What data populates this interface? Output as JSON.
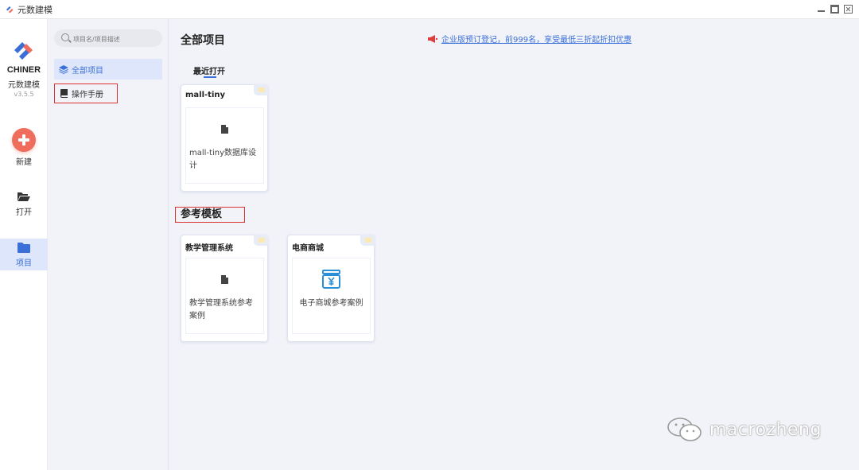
{
  "window": {
    "title": "元数建模"
  },
  "brand": {
    "name": "CHINER",
    "subtitle": "元数建模",
    "version": "v3.5.5"
  },
  "nav": {
    "new_label": "新建",
    "open_label": "打开",
    "project_label": "项目"
  },
  "sidebar": {
    "search_placeholder": "项目名/项目描述",
    "items": [
      {
        "label": "全部项目",
        "active": true
      },
      {
        "label": "操作手册",
        "active": false
      }
    ]
  },
  "main": {
    "title": "全部项目",
    "notice": "企业版预订登记，前999名，享受最低三折起折扣优惠",
    "recent_label": "最近打开",
    "recent_cards": [
      {
        "title": "mall-tiny",
        "desc": "mall-tiny数据库设计",
        "icon": "document-icon"
      }
    ],
    "templates_title": "参考模板",
    "template_cards": [
      {
        "title": "教学管理系统",
        "desc": "教学管理系统参考案例",
        "icon": "document-icon"
      },
      {
        "title": "电商商城",
        "desc": "电子商城参考案例",
        "icon": "money-icon"
      }
    ]
  },
  "watermark": {
    "text": "macrozheng"
  },
  "colors": {
    "accent": "#3a6fd8",
    "highlight_border": "#d9312e",
    "new_button": "#ef6d5c"
  }
}
